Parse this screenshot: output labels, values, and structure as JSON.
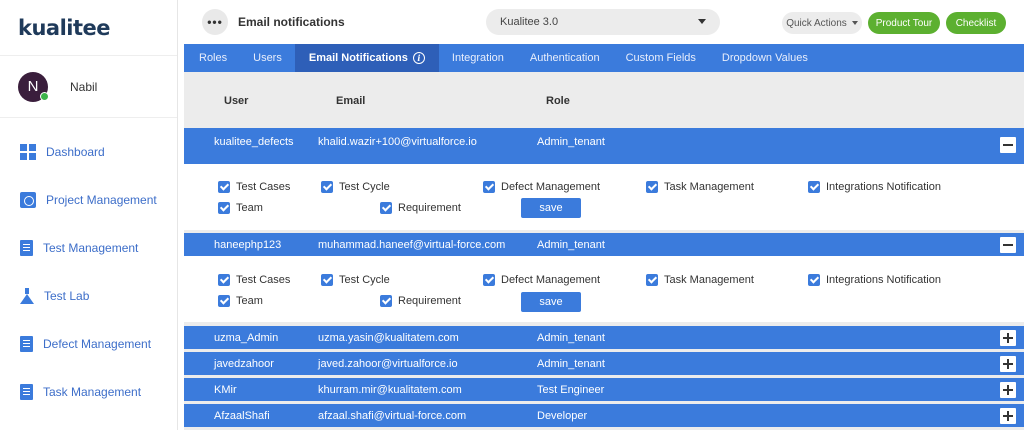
{
  "brand": {
    "logo_text": "kualitee"
  },
  "user": {
    "initial": "N",
    "name": "Nabil"
  },
  "sidebar": {
    "items": [
      {
        "label": "Dashboard",
        "icon": "dashboard-icon"
      },
      {
        "label": "Project Management",
        "icon": "project-icon"
      },
      {
        "label": "Test Management",
        "icon": "test-icon"
      },
      {
        "label": "Test Lab",
        "icon": "flask-icon"
      },
      {
        "label": "Defect Management",
        "icon": "defect-icon"
      },
      {
        "label": "Task Management",
        "icon": "task-icon"
      }
    ]
  },
  "header": {
    "more": "•••",
    "title": "Email notifications",
    "project": "Kualitee 3.0",
    "quick_actions": "Quick Actions",
    "product_tour": "Product Tour",
    "checklist": "Checklist"
  },
  "tabs": [
    "Roles",
    "Users",
    "Email Notifications",
    "Integration",
    "Authentication",
    "Custom Fields",
    "Dropdown Values"
  ],
  "info_glyph": "i",
  "columns": {
    "user": "User",
    "email": "Email",
    "role": "Role"
  },
  "permissions": {
    "test_cases": "Test Cases",
    "test_cycle": "Test Cycle",
    "defect_management": "Defect Management",
    "task_management": "Task Management",
    "integrations": "Integrations Notification",
    "team": "Team",
    "requirement": "Requirement",
    "save": "save"
  },
  "rows": [
    {
      "user": "kualitee_defects",
      "email": "khalid.wazir+100@virtualforce.io",
      "role": "Admin_tenant",
      "expanded": true
    },
    {
      "user": "haneephp123",
      "email": "muhammad.haneef@virtual-force.com",
      "role": "Admin_tenant",
      "expanded": true
    },
    {
      "user": "uzma_Admin",
      "email": "uzma.yasin@kualitatem.com",
      "role": "Admin_tenant",
      "expanded": false
    },
    {
      "user": "javedzahoor",
      "email": "javed.zahoor@virtualforce.io",
      "role": "Admin_tenant",
      "expanded": false
    },
    {
      "user": "KMir",
      "email": "khurram.mir@kualitatem.com",
      "role": "Test Engineer",
      "expanded": false
    },
    {
      "user": "AfzaalShafi",
      "email": "afzaal.shafi@virtual-force.com",
      "role": "Developer",
      "expanded": false
    }
  ],
  "colors": {
    "primary": "#3b7bdc",
    "active_tab": "#2e5fb8",
    "green": "#5cb030",
    "online": "#3cb34a"
  }
}
